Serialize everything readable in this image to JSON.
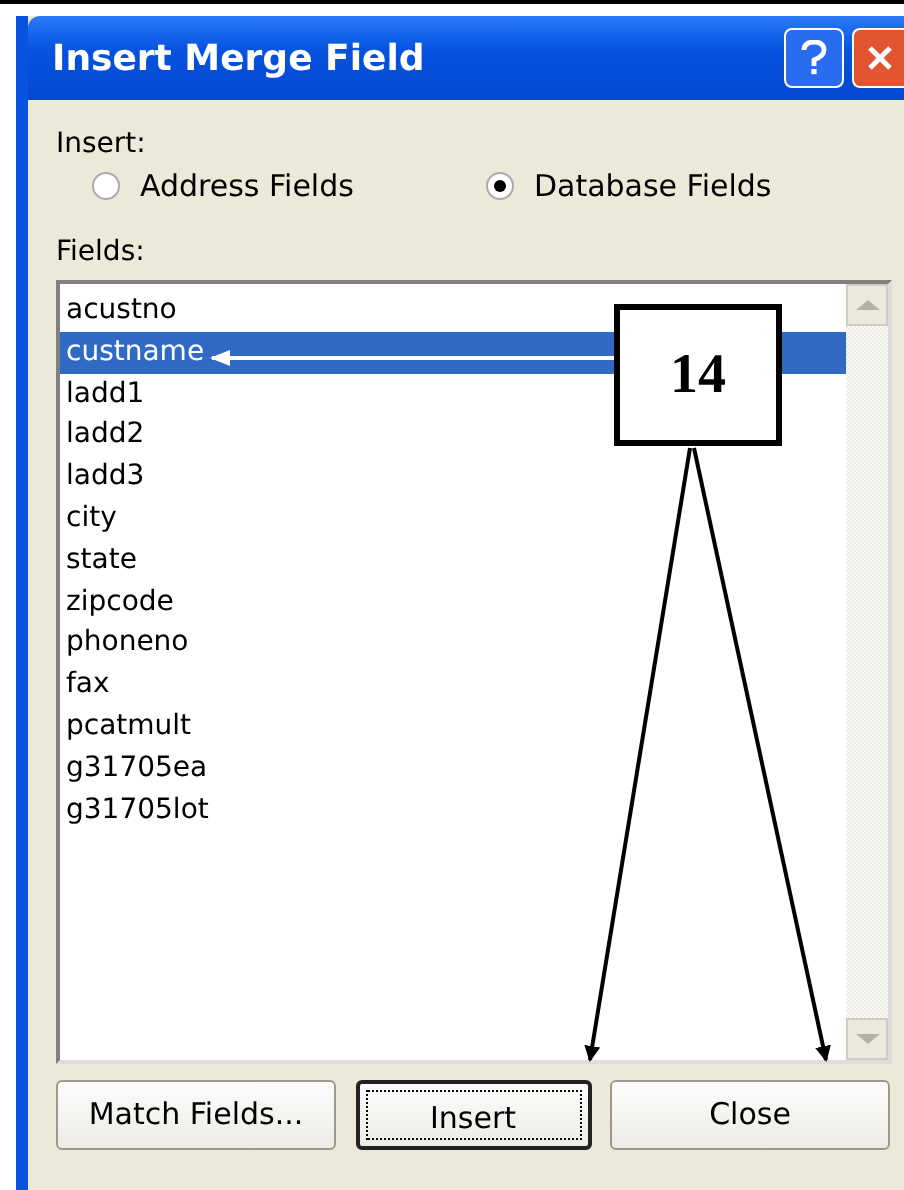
{
  "window": {
    "title": "Insert Merge Field"
  },
  "insert": {
    "label": "Insert:",
    "options": [
      {
        "label": "Address Fields",
        "selected": false
      },
      {
        "label": "Database Fields",
        "selected": true
      }
    ]
  },
  "fields": {
    "label": "Fields:",
    "items": [
      {
        "name": "acustno",
        "selected": false
      },
      {
        "name": "custname",
        "selected": true
      },
      {
        "name": "ladd1",
        "selected": false
      },
      {
        "name": "ladd2",
        "selected": false
      },
      {
        "name": "ladd3",
        "selected": false
      },
      {
        "name": "city",
        "selected": false
      },
      {
        "name": "state",
        "selected": false
      },
      {
        "name": "zipcode",
        "selected": false
      },
      {
        "name": "phoneno",
        "selected": false
      },
      {
        "name": "fax",
        "selected": false
      },
      {
        "name": "pcatmult",
        "selected": false
      },
      {
        "name": "g31705ea",
        "selected": false
      },
      {
        "name": "g31705lot",
        "selected": false
      }
    ]
  },
  "buttons": [
    {
      "label": "Match Fields...",
      "default": false
    },
    {
      "label": "Insert",
      "default": true
    },
    {
      "label": "Close",
      "default": false
    }
  ],
  "callout": {
    "label": "14"
  }
}
